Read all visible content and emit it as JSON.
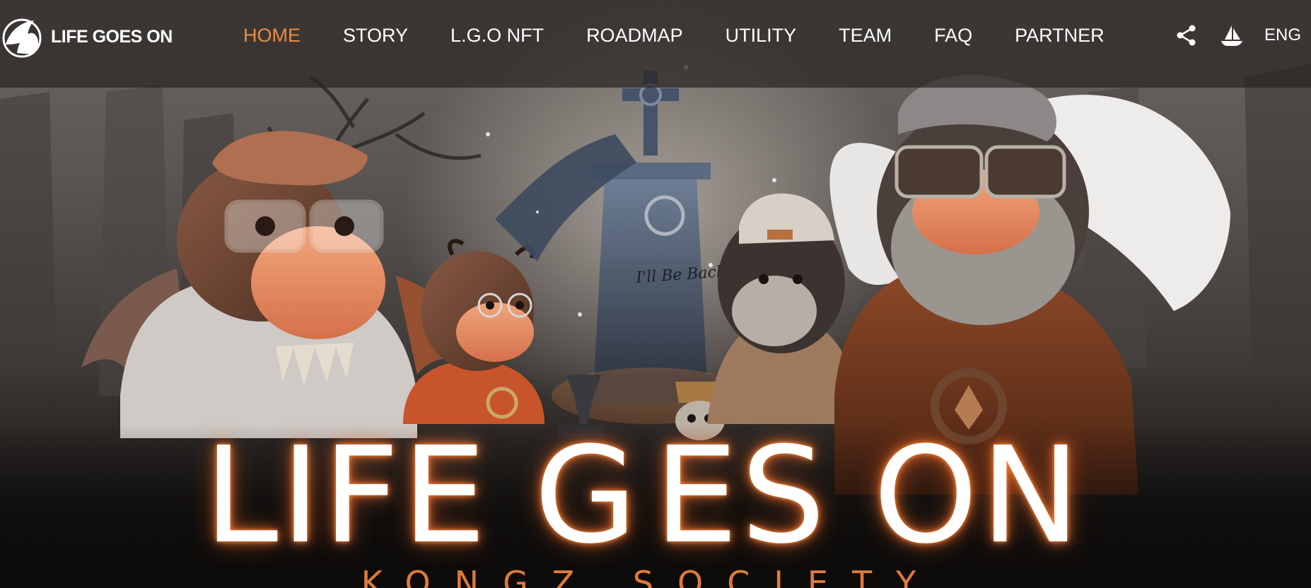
{
  "brand": {
    "name": "LIFE GOES ON",
    "logo_icon": "kongz-logo-icon"
  },
  "nav": {
    "items": [
      {
        "label": "HOME",
        "active": true
      },
      {
        "label": "STORY",
        "active": false
      },
      {
        "label": "L.G.O NFT",
        "active": false
      },
      {
        "label": "ROADMAP",
        "active": false
      },
      {
        "label": "UTILITY",
        "active": false
      },
      {
        "label": "TEAM",
        "active": false
      },
      {
        "label": "FAQ",
        "active": false
      },
      {
        "label": "PARTNER",
        "active": false
      }
    ],
    "share_icon": "share-icon",
    "marketplace_icon": "ship-icon",
    "language": "ENG"
  },
  "hero": {
    "title_part1": "LIFE G",
    "title_part2": "ES ON",
    "subtitle": "KONGZ SOCIETY",
    "tombstone_text": "I'll Be Back"
  },
  "colors": {
    "accent": "#f08a3e",
    "nav_bg": "#2a2624",
    "glow": "#ff8a3c"
  }
}
